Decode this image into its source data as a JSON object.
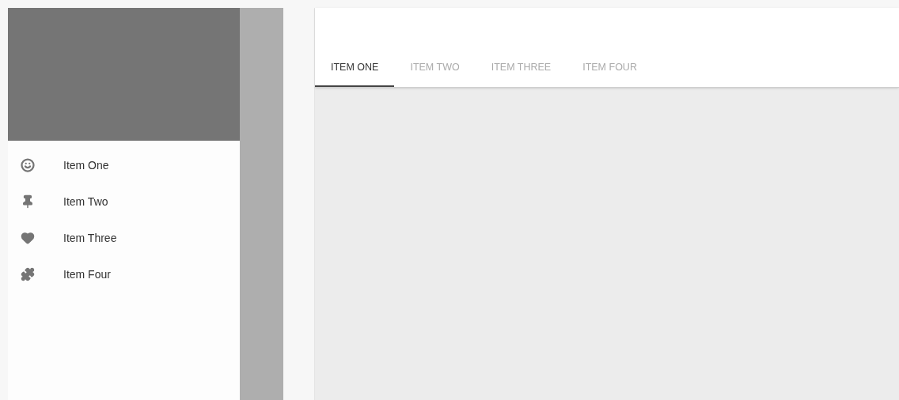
{
  "drawer": {
    "items": [
      {
        "label": "Item One"
      },
      {
        "label": "Item Two"
      },
      {
        "label": "Item Three"
      },
      {
        "label": "Item Four"
      }
    ]
  },
  "tabs": [
    {
      "label": "ITEM ONE",
      "selected": true
    },
    {
      "label": "ITEM TWO",
      "selected": false
    },
    {
      "label": "ITEM THREE",
      "selected": false
    },
    {
      "label": "ITEM FOUR",
      "selected": false
    }
  ]
}
